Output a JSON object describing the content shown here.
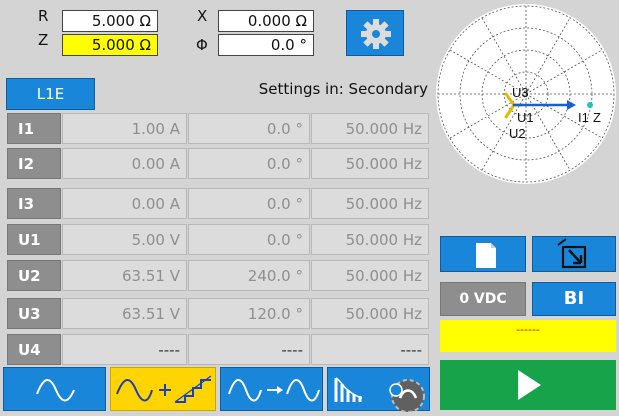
{
  "impedance": {
    "r_label": "R",
    "r_value": "5.000 Ω",
    "z_label": "Z",
    "z_value": "5.000 Ω",
    "x_label": "X",
    "x_value": "0.000 Ω",
    "phi_label": "Φ",
    "phi_value": "0.0 °"
  },
  "mode_button": "L1E",
  "settings_text": "Settings in: Secondary",
  "rows": [
    {
      "label": "I1",
      "mag": "1.00 A",
      "angle": "0.0 °",
      "freq": "50.000 Hz"
    },
    {
      "label": "I2",
      "mag": "0.00 A",
      "angle": "0.0 °",
      "freq": "50.000 Hz"
    },
    {
      "label": "I3",
      "mag": "0.00 A",
      "angle": "0.0 °",
      "freq": "50.000 Hz"
    },
    {
      "label": "U1",
      "mag": "5.00 V",
      "angle": "0.0 °",
      "freq": "50.000 Hz"
    },
    {
      "label": "U2",
      "mag": "63.51 V",
      "angle": "240.0 °",
      "freq": "50.000 Hz"
    },
    {
      "label": "U3",
      "mag": "63.51 V",
      "angle": "120.0 °",
      "freq": "50.000 Hz"
    },
    {
      "label": "U4",
      "mag": "----",
      "angle": "----",
      "freq": "----"
    }
  ],
  "phasor": {
    "labels": {
      "u3": "U3",
      "u1": "U1",
      "u2": "U2",
      "i1": "I1",
      "z": "Z"
    },
    "colors": {
      "voltage": "#e8b800",
      "current": "#1a5fd1",
      "z": "#18c6c6"
    }
  },
  "dc_button": "0 VDC",
  "bi_button": "BI",
  "status_text": "------",
  "icons": {
    "gear": "gear-icon",
    "new_file": "new-file-icon",
    "export": "export-icon",
    "sine": "sine-wave-icon",
    "sine_ramp": "sine-ramp-icon",
    "sine_sequence": "sine-sequence-icon",
    "harmonics": "harmonics-icon",
    "play": "play-icon"
  },
  "colors": {
    "accent_blue": "#1a86d9",
    "highlight_yellow": "#ffff00",
    "selected_tab": "#ffd400",
    "go_green": "#16a34a",
    "row_label_gray": "#8e8e8e"
  }
}
